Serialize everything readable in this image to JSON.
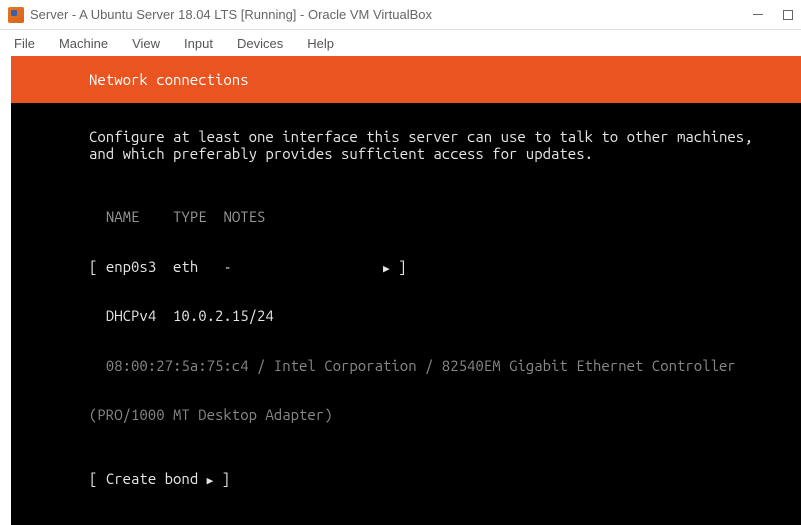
{
  "titlebar": {
    "title": "Server - A Ubuntu Server 18.04 LTS  [Running] - Oracle VM VirtualBox"
  },
  "menubar": {
    "file": "File",
    "machine": "Machine",
    "view": "View",
    "input": "Input",
    "devices": "Devices",
    "help": "Help"
  },
  "installer": {
    "header": "Network connections",
    "desc1": "Configure at least one interface this server can use to talk to other machines,",
    "desc2": "and which preferably provides sufficient access for updates.",
    "col_name": "NAME",
    "col_type": "TYPE",
    "col_notes": "NOTES",
    "iface_name": "enp0s3",
    "iface_type": "eth",
    "iface_notes": "-",
    "dhcp_label": "DHCPv4",
    "dhcp_value": "10.0.2.15/24",
    "hwinfo1": "  08:00:27:5a:75:c4 / Intel Corporation / 82540EM Gigabit Ethernet Controller",
    "hwinfo2": "(PRO/1000 MT Desktop Adapter)",
    "create_bond": "Create bond"
  }
}
